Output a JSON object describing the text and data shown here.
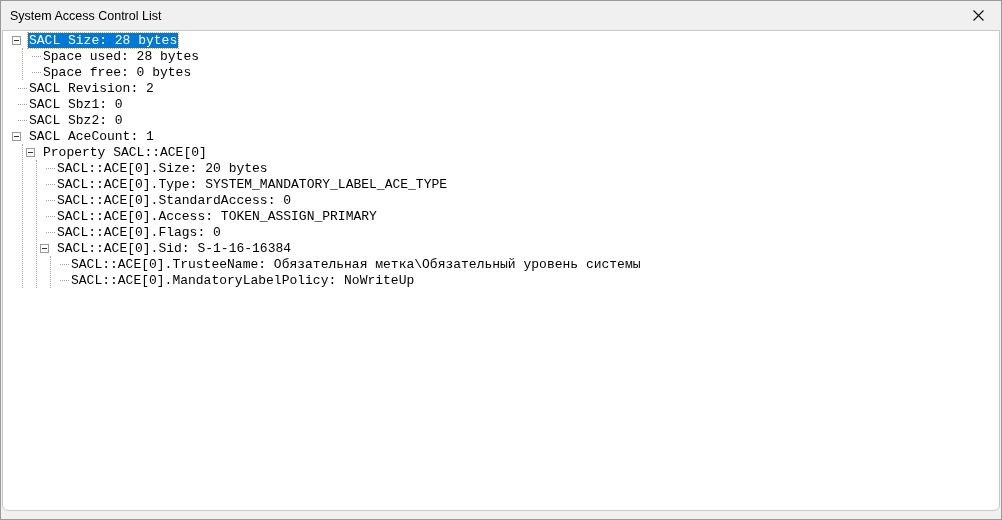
{
  "window": {
    "title": "System Access Control List"
  },
  "tree": [
    {
      "label": "SACL Size: 28 bytes",
      "selected": true,
      "expanded": true,
      "children": [
        {
          "label": "Space used: 28 bytes",
          "selected": false
        },
        {
          "label": "Space free: 0 bytes",
          "selected": false
        }
      ]
    },
    {
      "label": "SACL Revision: 2",
      "selected": false
    },
    {
      "label": "SACL Sbz1: 0",
      "selected": false
    },
    {
      "label": "SACL Sbz2: 0",
      "selected": false
    },
    {
      "label": "SACL AceCount: 1",
      "selected": false,
      "expanded": true,
      "children": [
        {
          "label": "Property SACL::ACE[0]",
          "selected": false,
          "expanded": true,
          "children": [
            {
              "label": "SACL::ACE[0].Size: 20 bytes",
              "selected": false
            },
            {
              "label": "SACL::ACE[0].Type: SYSTEM_MANDATORY_LABEL_ACE_TYPE",
              "selected": false
            },
            {
              "label": "SACL::ACE[0].StandardAccess: 0",
              "selected": false
            },
            {
              "label": "SACL::ACE[0].Access: TOKEN_ASSIGN_PRIMARY",
              "selected": false
            },
            {
              "label": "SACL::ACE[0].Flags: 0",
              "selected": false
            },
            {
              "label": "SACL::ACE[0].Sid: S-1-16-16384",
              "selected": false,
              "expanded": true,
              "children": [
                {
                  "label": "SACL::ACE[0].TrusteeName: Обязательная метка\\Обязательный уровень системы",
                  "selected": false
                },
                {
                  "label": "SACL::ACE[0].MandatoryLabelPolicy: NoWriteUp",
                  "selected": false
                }
              ]
            }
          ]
        }
      ]
    }
  ]
}
